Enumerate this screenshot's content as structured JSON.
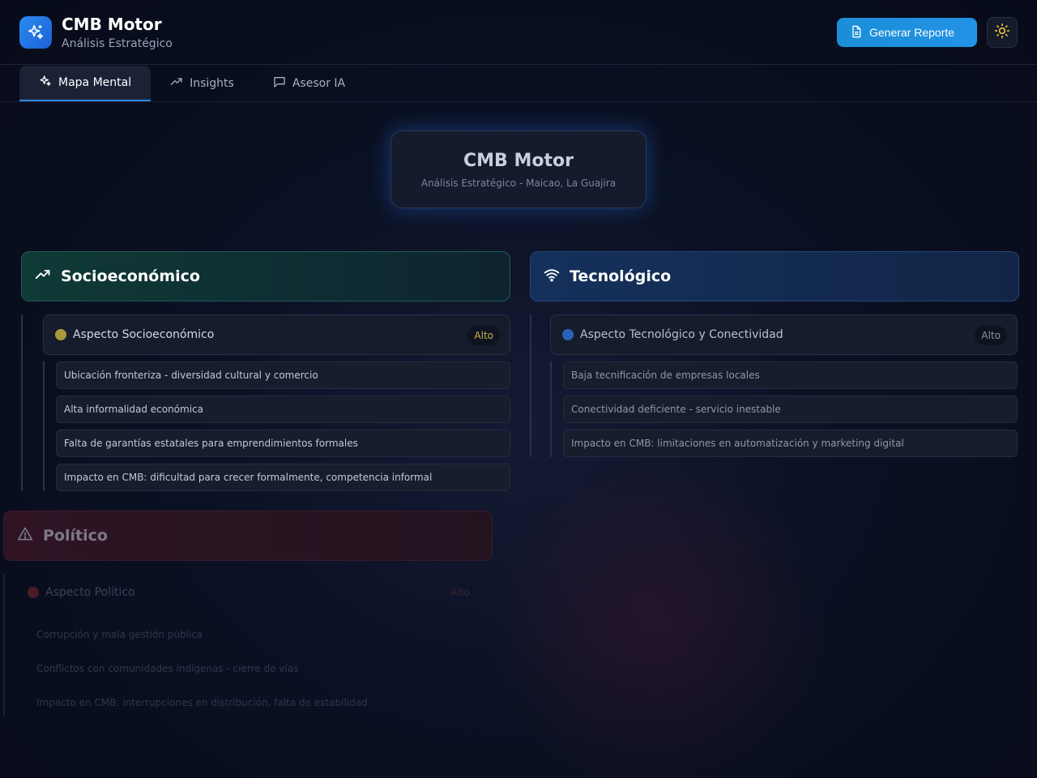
{
  "header": {
    "title": "CMB Motor",
    "subtitle": "Análisis Estratégico",
    "report_button": "Generar Reporte"
  },
  "tabs": [
    {
      "label": "Mapa Mental",
      "active": true
    },
    {
      "label": "Insights",
      "active": false
    },
    {
      "label": "Asesor IA",
      "active": false
    }
  ],
  "central": {
    "title": "CMB Motor",
    "subtitle": "Análisis Estratégico - Maicao, La Guajira"
  },
  "categories": {
    "socio": {
      "title": "Socioeconómico",
      "icon": "trending-up-icon",
      "aspect": "Aspecto Socioeconómico",
      "level": "Alto",
      "dot_color": "#a89a3a",
      "badge_color": "#c9b24a",
      "items": [
        "Ubicación fronteriza - diversidad cultural y comercio",
        "Alta informalidad económica",
        "Falta de garantías estatales para emprendimientos formales",
        "Impacto en CMB: dificultad para crecer formalmente, competencia informal"
      ]
    },
    "tech": {
      "title": "Tecnológico",
      "icon": "wifi-icon",
      "aspect": "Aspecto Tecnológico y Conectividad",
      "level": "Alto",
      "dot_color": "#2a62b8",
      "badge_color": "#8d95a8",
      "items": [
        "Baja tecnificación de empresas locales",
        "Conectividad deficiente - servicio inestable",
        "Impacto en CMB: limitaciones en automatización y marketing digital"
      ]
    },
    "pol": {
      "title": "Político",
      "icon": "warning-icon",
      "aspect": "Aspecto Político",
      "level": "Alto",
      "dot_color": "#4a1a26",
      "badge_color": "#3a2430",
      "items": [
        "Corrupción y mala gestión pública",
        "Conflictos con comunidades indígenas - cierre de vías",
        "Impacto en CMB: interrupciones en distribución, falta de estabilidad"
      ]
    }
  },
  "colors": {
    "accent": "#2392e6",
    "sun": "#e9c23a"
  }
}
